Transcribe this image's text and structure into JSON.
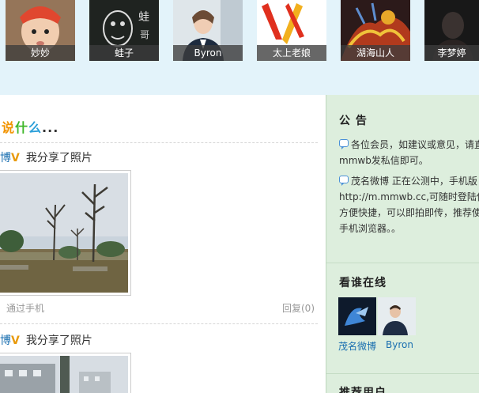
{
  "avatars": [
    {
      "name": "妙妙",
      "icon": "avatar-icon"
    },
    {
      "name": "蛙子",
      "icon": "avatar-icon"
    },
    {
      "name": "Byron",
      "icon": "avatar-icon"
    },
    {
      "name": "太上老娘",
      "icon": "avatar-icon"
    },
    {
      "name": "湖海山人",
      "icon": "avatar-icon"
    },
    {
      "name": "李梦婷",
      "icon": "avatar-icon"
    }
  ],
  "feed": {
    "heading": {
      "p1": "说",
      "p2": "什",
      "p3": "么",
      "p4": "..."
    },
    "posts": [
      {
        "user": "博",
        "v": "V",
        "text": "我分享了照片",
        "from": "通过手机",
        "reply": "回复(0)"
      },
      {
        "user": "博",
        "v": "V",
        "text": "我分享了照片"
      }
    ]
  },
  "sidebar": {
    "notice_title": "公 告",
    "notice_lines": [
      "各位会员，如建议或意见，请直",
      "mmwb发私信即可。",
      "茂名微博 正在公测中，手机版",
      "http://m.mmwb.cc,可随时登陆使",
      "方便快捷，可以即拍即传，推荐使",
      "手机浏览器。。"
    ],
    "online_title": "看谁在线",
    "online_users": [
      "茂名微博",
      "Byron"
    ],
    "recommend_title": "推荐用户"
  },
  "colors": {
    "top_strip": "#e3f3fa",
    "sidebar_bg": "#ddeedd",
    "link": "#1a6fb0",
    "v_badge": "#e89a0c"
  }
}
